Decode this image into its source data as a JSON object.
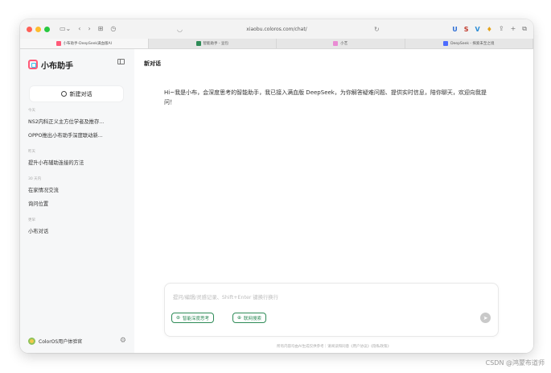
{
  "browser": {
    "url": "xiaobu.coloros.com/chat/",
    "tabs": [
      {
        "label": "小布助手-DeepSeek满血版AI",
        "icon_color": "#ff5a78",
        "active": true
      },
      {
        "label": "智能助手 - 豆包",
        "icon_color": "#2e8b57",
        "active": false
      },
      {
        "label": "小艺",
        "icon_color": "#e98bd3",
        "active": false
      },
      {
        "label": "DeepSeek - 探索未至之境",
        "icon_color": "#4d6bfe",
        "active": false
      }
    ],
    "extensions": [
      {
        "label": "U",
        "color": "#2f6fd6"
      },
      {
        "label": "S",
        "color": "#c0392b"
      },
      {
        "label": "V",
        "color": "#2b8cd6"
      },
      {
        "label": "♦",
        "color": "#e4a21a"
      }
    ]
  },
  "sidebar": {
    "brand": "小布助手",
    "new_chat_label": "新建对话",
    "groups": [
      {
        "label": "今天",
        "items": [
          "NS2内科正义主方位学者及推存...",
          "OPPO推出小布助手深度联动新..."
        ]
      },
      {
        "label": "昨天",
        "items": [
          "提升小布辅助连接的方法"
        ]
      },
      {
        "label": "30 天内",
        "items": [
          "在家情况交流",
          "询问位置"
        ]
      },
      {
        "label": "更早",
        "items": [
          "小布对话"
        ]
      }
    ],
    "user_name": "ColorOS用户体验官"
  },
  "main": {
    "title": "新对话",
    "greeting": "Hi~我是小布，会深度思考的智能助手，我已接入满血版 DeepSeek，为你解答疑难问题、提供实时信息，陪你聊天，欢迎向我提问！",
    "input_placeholder": "提问/编辑/灵感记录、Shift+Enter 键换行换行",
    "pills": [
      {
        "label": "智能深度思考",
        "icon": "brain-icon"
      },
      {
        "label": "联网搜索",
        "icon": "globe-icon"
      }
    ],
    "disclaimer": "所有内容均由AI生成仅供参考｜请阅读和同意《用户协议》《隐私政策》"
  },
  "watermark": "CSDN @鸿蒙布道师"
}
